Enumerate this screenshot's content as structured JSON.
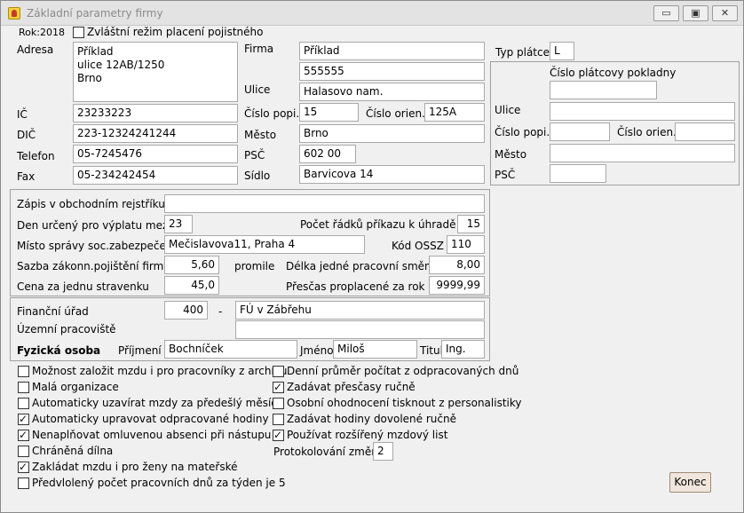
{
  "window": {
    "title": "Základní parametry firmy",
    "minimize": "▭",
    "maximize": "▣",
    "close": "✕"
  },
  "top": {
    "year": "Rok:2018",
    "special_mode": "Zvláštní režim placení pojistného",
    "special_mode_checked": false
  },
  "left": {
    "address_label": "Adresa",
    "address_value": "Příklad\nulice 12AB/1250\nBrno",
    "ic_label": "IČ",
    "ic_value": "23233223",
    "dic_label": "DIČ",
    "dic_value": "223-12324241244",
    "phone_label": "Telefon",
    "phone_value": "05-7245476",
    "fax_label": "Fax",
    "fax_value": "05-234242454"
  },
  "company": {
    "firm_label": "Firma",
    "firm_value1": "Příklad",
    "firm_value2": "555555",
    "street_label": "Ulice",
    "street_value": "Halasovo nam.",
    "house_label": "Číslo popi.",
    "house_value": "15",
    "orient_label": "Číslo orien..",
    "orient_value": "125A",
    "city_label": "Město",
    "city_value": "Brno",
    "zip_label": "PSČ",
    "zip_value": "602 00",
    "seat_label": "Sídlo",
    "seat_value": "Barvicova 14"
  },
  "payer": {
    "type_label": "Typ plátce",
    "type_value": "L",
    "cashier_label": "Číslo plátcovy pokladny",
    "cashier_value": "",
    "street_label": "Ulice",
    "street_value": "",
    "house_label": "Číslo popi.",
    "house_value": "",
    "orient_label": "Číslo orien..",
    "orient_value": "",
    "city_label": "Město",
    "city_value": "",
    "zip_label": "PSČ",
    "zip_value": ""
  },
  "registry": {
    "record_label": "Zápis v obchodním rejstříku",
    "record_value": "",
    "payday_label": "Den určený pro výplatu mezd",
    "payday_value": "23",
    "rows_label": "Počet řádků příkazu k úhradě",
    "rows_value": "15",
    "place_label": "Místo správy  soc.zabezpečení",
    "place_value": "Mečislavova11, Praha 4",
    "ossz_label": "Kód OSSZ",
    "ossz_value": "110",
    "rate_label": "Sazba zákonn.pojištění firmy",
    "rate_value": "5,60",
    "rate_unit": "promile",
    "shift_label": "Délka jedné pracovní směny",
    "shift_value": "8,00",
    "meal_label": "Cena za jednu stravenku",
    "meal_value": "45,0",
    "overtime_label": "Přesčas proplacené za rok",
    "overtime_value": "9999,99"
  },
  "office": {
    "tax_office_label": "Finanční úřad",
    "tax_office_code": "400",
    "dash": "-",
    "tax_office_name": "FÚ v Zábřehu",
    "workplace_label": "Územní pracoviště",
    "workplace_value": "",
    "person_label": "Fyzická osoba",
    "surname_label": "Příjmení",
    "surname_value": "Bochníček",
    "name_label": "Jméno",
    "name_value": "Miloš",
    "title_label": "Titul",
    "title_value": "Ing."
  },
  "options_left": [
    {
      "label": "Možnost založit mzdu i pro pracovníky z archívu",
      "checked": false
    },
    {
      "label": "Malá organizace",
      "checked": false
    },
    {
      "label": "Automaticky uzavírat mzdy za předešlý měsíc",
      "checked": false
    },
    {
      "label": "Automaticky upravovat odpracované hodiny",
      "checked": true
    },
    {
      "label": "Nenaplňovat omluvenou absenci při nástupu",
      "checked": true
    },
    {
      "label": "Chráněná dílna",
      "checked": false
    },
    {
      "label": "Zakládat mzdu i pro ženy na mateřské",
      "checked": true
    },
    {
      "label": "Předvlolený počet pracovních dnů za týden je 5",
      "checked": false
    }
  ],
  "options_right": [
    {
      "label": "Denní průměr počítat z odpracovaných dnů",
      "checked": false
    },
    {
      "label": "Zadávat přesčasy ručně",
      "checked": true
    },
    {
      "label": "Osobní ohodnocení tisknout z personalistiky",
      "checked": false
    },
    {
      "label": "Zadávat hodiny dovolené ručně",
      "checked": false
    },
    {
      "label": "Používat rozšířený mzdový list",
      "checked": true
    }
  ],
  "protocol": {
    "label": "Protokolování změn",
    "value": "2"
  },
  "footer": {
    "close_button": "Konec"
  }
}
